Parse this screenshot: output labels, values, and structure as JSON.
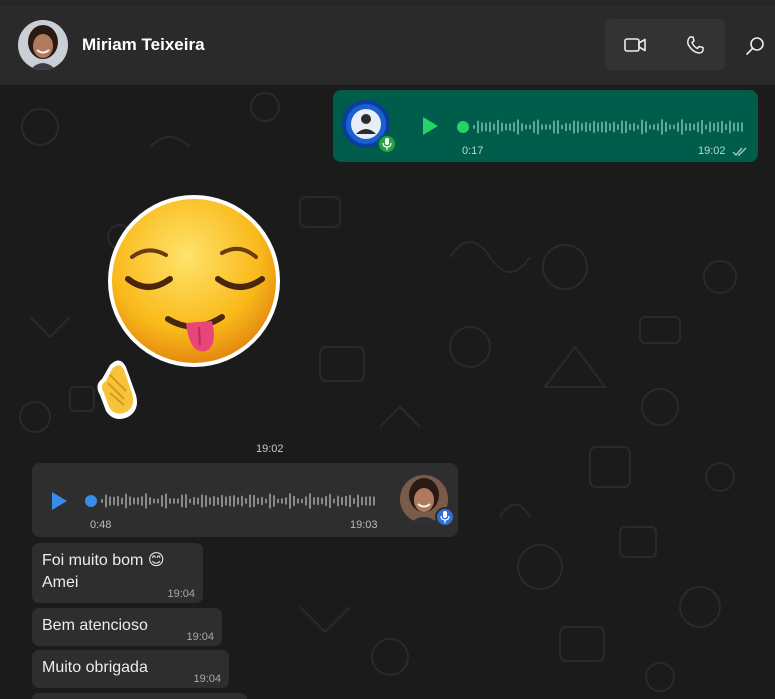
{
  "header": {
    "contact_name": "Miriam Teixeira",
    "avatar_icon": "contact-avatar",
    "video_call_icon": "video-camera-icon",
    "voice_call_icon": "phone-icon",
    "search_icon": "search-icon"
  },
  "chat": {
    "outgoing_audio": {
      "duration": "0:17",
      "time": "19:02",
      "status_icon": "double-check-icon",
      "progress": 0.0
    },
    "sticker": {
      "description_icon": "relieved-tongue-emoji-sticker",
      "time": "19:02"
    },
    "incoming_audio": {
      "duration": "0:48",
      "time": "19:03",
      "progress": 0.0
    },
    "messages": [
      {
        "text": "Foi muito bom 😊\nAmei",
        "time": "19:04"
      },
      {
        "text": "Bem atencioso",
        "time": "19:04"
      },
      {
        "text": "Muito obrigada",
        "time": "19:04"
      }
    ]
  },
  "colors": {
    "outgoing_bubble": "#005c4b",
    "incoming_bubble": "#2e2e2e",
    "play_outgoing": "#25d366",
    "play_incoming": "#3b8be8",
    "background": "#1b1b1b"
  }
}
